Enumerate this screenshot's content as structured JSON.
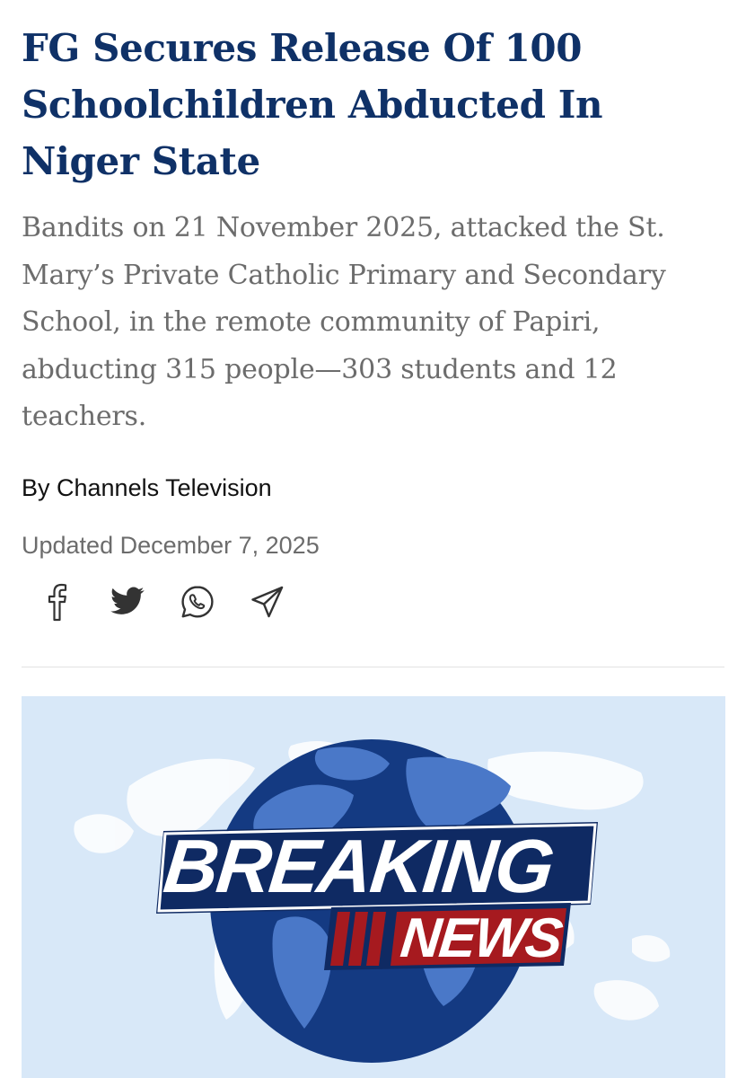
{
  "article": {
    "headline": "FG Secures Release Of 100 Schoolchildren Abducted In Niger State",
    "summary": "Bandits on 21 November 2025, attacked the St. Mary’s Private Catholic Primary and Secondary School, in the remote community of Papiri, abducting 315 people—303 students and 12 teachers.",
    "byline": "By Channels Television",
    "updated": "Updated December 7, 2025"
  },
  "share": {
    "icons": [
      "facebook-icon",
      "twitter-icon",
      "whatsapp-icon",
      "telegram-icon"
    ],
    "icon_color": "#333333"
  },
  "banner": {
    "breaking_text": "BREAKING",
    "news_text": "NEWS",
    "colors": {
      "background": "#d8e8f8",
      "globe": "#143a82",
      "continents": "#4a78c8",
      "band": "#0f2a63",
      "news_band": "#a61a1f",
      "text": "#ffffff"
    }
  },
  "theme": {
    "headline_color": "#0f3167",
    "summary_color": "#6c6c6c",
    "byline_color": "#111111"
  }
}
